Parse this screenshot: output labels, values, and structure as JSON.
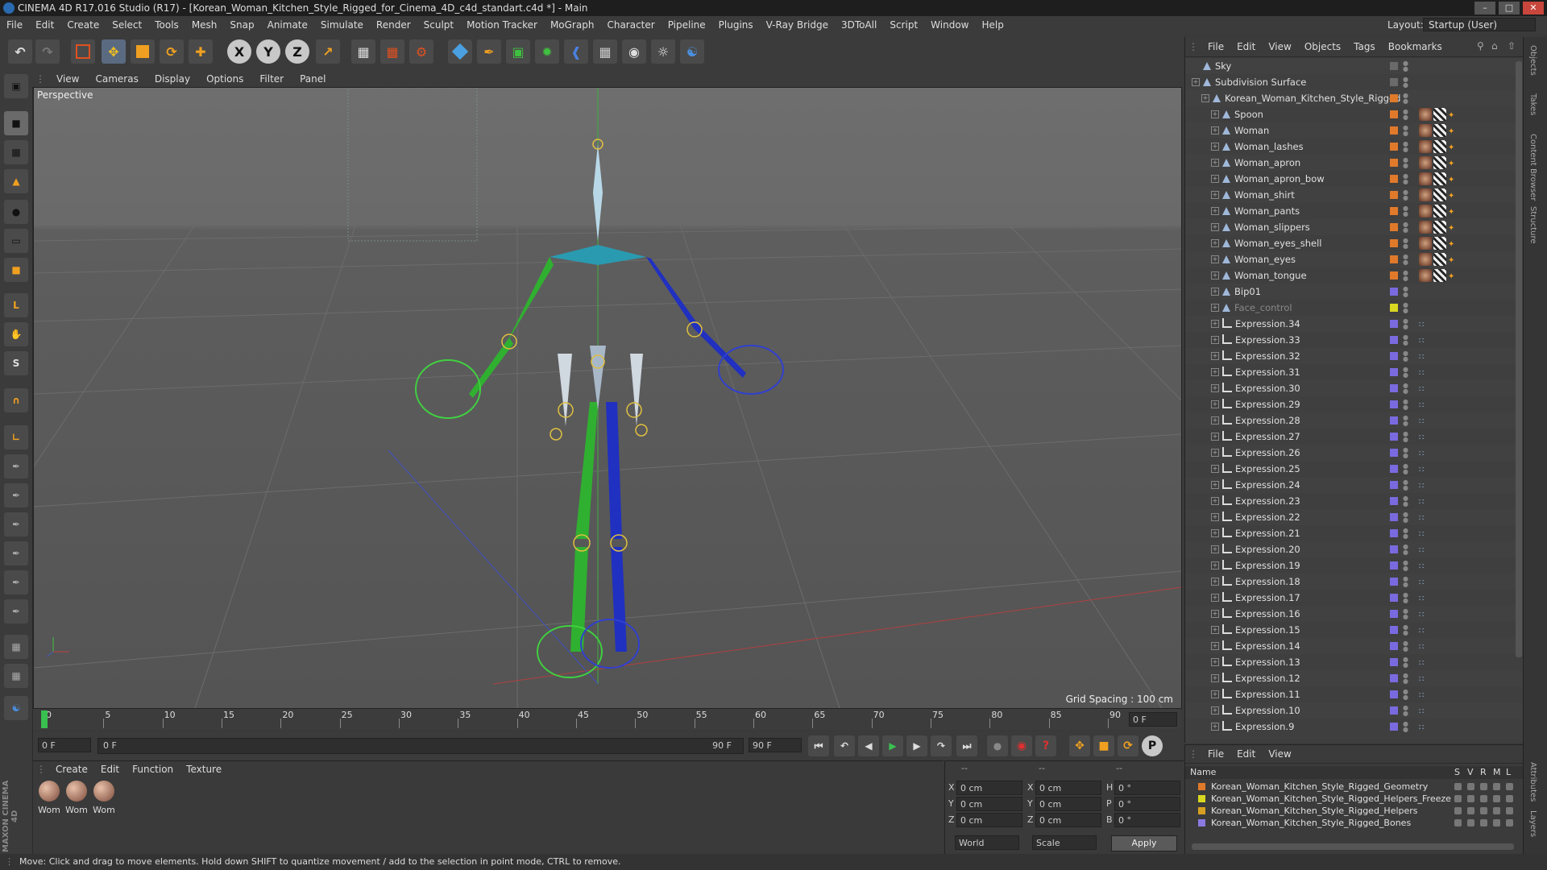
{
  "window": {
    "title": "CINEMA 4D R17.016 Studio (R17) - [Korean_Woman_Kitchen_Style_Rigged_for_Cinema_4D_c4d_standart.c4d *] - Main"
  },
  "menu": [
    "File",
    "Edit",
    "Create",
    "Select",
    "Tools",
    "Mesh",
    "Snap",
    "Animate",
    "Simulate",
    "Render",
    "Sculpt",
    "Motion Tracker",
    "MoGraph",
    "Character",
    "Pipeline",
    "Plugins",
    "V-Ray Bridge",
    "3DToAll",
    "Script",
    "Window",
    "Help"
  ],
  "layout": {
    "label": "Layout:",
    "value": "Startup (User)"
  },
  "toolbar": {
    "axis_x": "X",
    "axis_y": "Y",
    "axis_z": "Z"
  },
  "viewport": {
    "menu": [
      "View",
      "Cameras",
      "Display",
      "Options",
      "Filter",
      "Panel"
    ],
    "label": "Perspective",
    "grid_spacing": "Grid Spacing : 100 cm"
  },
  "timeline": {
    "ticks": [
      "0",
      "5",
      "10",
      "15",
      "20",
      "25",
      "30",
      "35",
      "40",
      "45",
      "50",
      "55",
      "60",
      "65",
      "70",
      "75",
      "80",
      "85",
      "90"
    ],
    "current_frame": "0 F",
    "start_field": "0 F",
    "range_start": "0 F",
    "range_end": "90 F",
    "end_field": "90 F"
  },
  "materials": {
    "menu": [
      "Create",
      "Edit",
      "Function",
      "Texture"
    ],
    "items": [
      "Wom",
      "Wom",
      "Wom"
    ]
  },
  "coords": {
    "header": [
      "--",
      "--",
      "--"
    ],
    "rows": [
      {
        "a": "X",
        "av": "0 cm",
        "b": "X",
        "bv": "0 cm",
        "c": "H",
        "cv": "0 °"
      },
      {
        "a": "Y",
        "av": "0 cm",
        "b": "Y",
        "bv": "0 cm",
        "c": "P",
        "cv": "0 °"
      },
      {
        "a": "Z",
        "av": "0 cm",
        "b": "Z",
        "bv": "0 cm",
        "c": "B",
        "cv": "0 °"
      }
    ],
    "world": "World",
    "scale": "Scale",
    "apply": "Apply"
  },
  "objects": {
    "menu": [
      "File",
      "Edit",
      "View",
      "Objects",
      "Tags",
      "Bookmarks"
    ],
    "items": [
      {
        "name": "Sky",
        "indent": 0,
        "color": "#6a6a6a"
      },
      {
        "name": "Subdivision Surface",
        "indent": 0,
        "color": "#6a6a6a"
      },
      {
        "name": "Korean_Woman_Kitchen_Style_Rigged",
        "indent": 1,
        "color": "#e07a2a"
      },
      {
        "name": "Spoon",
        "indent": 2,
        "color": "#e07a2a"
      },
      {
        "name": "Woman",
        "indent": 2,
        "color": "#e07a2a"
      },
      {
        "name": "Woman_lashes",
        "indent": 2,
        "color": "#e07a2a"
      },
      {
        "name": "Woman_apron",
        "indent": 2,
        "color": "#e07a2a"
      },
      {
        "name": "Woman_apron_bow",
        "indent": 2,
        "color": "#e07a2a"
      },
      {
        "name": "Woman_shirt",
        "indent": 2,
        "color": "#e07a2a"
      },
      {
        "name": "Woman_pants",
        "indent": 2,
        "color": "#e07a2a"
      },
      {
        "name": "Woman_slippers",
        "indent": 2,
        "color": "#e07a2a"
      },
      {
        "name": "Woman_eyes_shell",
        "indent": 2,
        "color": "#e07a2a"
      },
      {
        "name": "Woman_eyes",
        "indent": 2,
        "color": "#e07a2a"
      },
      {
        "name": "Woman_tongue",
        "indent": 2,
        "color": "#e07a2a"
      },
      {
        "name": "Bip01",
        "indent": 2,
        "color": "#7a6ae0"
      },
      {
        "name": "Face_control",
        "indent": 2,
        "color": "#d8d820"
      },
      {
        "name": "Expression.34",
        "indent": 2,
        "color": "#7a6ae0"
      },
      {
        "name": "Expression.33",
        "indent": 2,
        "color": "#7a6ae0"
      },
      {
        "name": "Expression.32",
        "indent": 2,
        "color": "#7a6ae0"
      },
      {
        "name": "Expression.31",
        "indent": 2,
        "color": "#7a6ae0"
      },
      {
        "name": "Expression.30",
        "indent": 2,
        "color": "#7a6ae0"
      },
      {
        "name": "Expression.29",
        "indent": 2,
        "color": "#7a6ae0"
      },
      {
        "name": "Expression.28",
        "indent": 2,
        "color": "#7a6ae0"
      },
      {
        "name": "Expression.27",
        "indent": 2,
        "color": "#7a6ae0"
      },
      {
        "name": "Expression.26",
        "indent": 2,
        "color": "#7a6ae0"
      },
      {
        "name": "Expression.25",
        "indent": 2,
        "color": "#7a6ae0"
      },
      {
        "name": "Expression.24",
        "indent": 2,
        "color": "#7a6ae0"
      },
      {
        "name": "Expression.23",
        "indent": 2,
        "color": "#7a6ae0"
      },
      {
        "name": "Expression.22",
        "indent": 2,
        "color": "#7a6ae0"
      },
      {
        "name": "Expression.21",
        "indent": 2,
        "color": "#7a6ae0"
      },
      {
        "name": "Expression.20",
        "indent": 2,
        "color": "#7a6ae0"
      },
      {
        "name": "Expression.19",
        "indent": 2,
        "color": "#7a6ae0"
      },
      {
        "name": "Expression.18",
        "indent": 2,
        "color": "#7a6ae0"
      },
      {
        "name": "Expression.17",
        "indent": 2,
        "color": "#7a6ae0"
      },
      {
        "name": "Expression.16",
        "indent": 2,
        "color": "#7a6ae0"
      },
      {
        "name": "Expression.15",
        "indent": 2,
        "color": "#7a6ae0"
      },
      {
        "name": "Expression.14",
        "indent": 2,
        "color": "#7a6ae0"
      },
      {
        "name": "Expression.13",
        "indent": 2,
        "color": "#7a6ae0"
      },
      {
        "name": "Expression.12",
        "indent": 2,
        "color": "#7a6ae0"
      },
      {
        "name": "Expression.11",
        "indent": 2,
        "color": "#7a6ae0"
      },
      {
        "name": "Expression.10",
        "indent": 2,
        "color": "#7a6ae0"
      },
      {
        "name": "Expression.9",
        "indent": 2,
        "color": "#7a6ae0"
      }
    ]
  },
  "layers": {
    "menu": [
      "File",
      "Edit",
      "View"
    ],
    "columns": {
      "name": "Name",
      "s": "S",
      "v": "V",
      "r": "R",
      "m": "M",
      "l": "L"
    },
    "items": [
      {
        "name": "Korean_Woman_Kitchen_Style_Rigged_Geometry",
        "color": "#e07a2a"
      },
      {
        "name": "Korean_Woman_Kitchen_Style_Rigged_Helpers_Freeze",
        "color": "#d8d820"
      },
      {
        "name": "Korean_Woman_Kitchen_Style_Rigged_Helpers",
        "color": "#d8a020"
      },
      {
        "name": "Korean_Woman_Kitchen_Style_Rigged_Bones",
        "color": "#8a7ae0"
      }
    ]
  },
  "right_tabs": [
    "Objects",
    "Takes",
    "Content Browser",
    "Structure",
    "Attributes",
    "Layers"
  ],
  "status": "Move: Click and drag to move elements. Hold down SHIFT to quantize movement / add to the selection in point mode, CTRL to remove."
}
